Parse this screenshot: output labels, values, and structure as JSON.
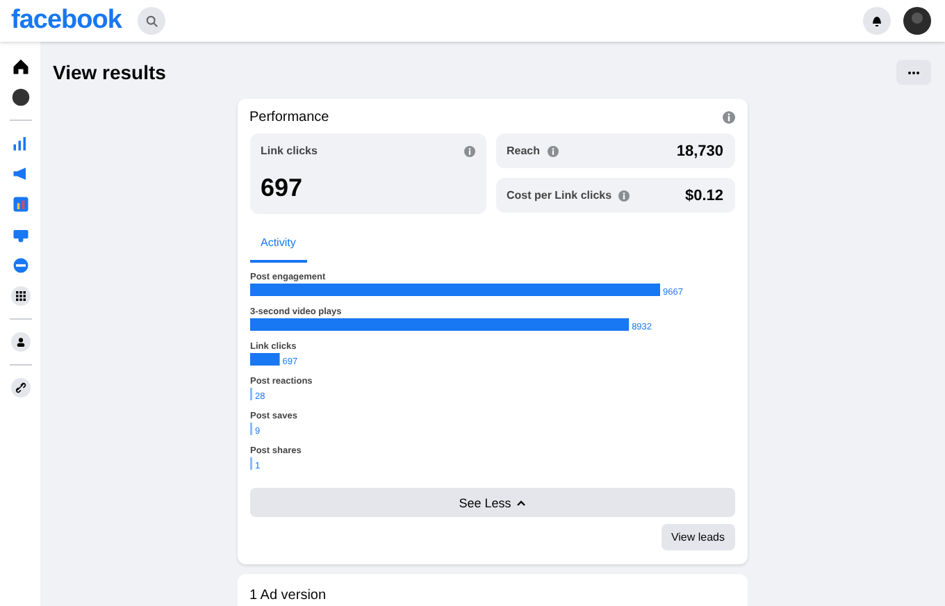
{
  "topbar": {
    "logo": "facebook"
  },
  "page": {
    "title": "View results"
  },
  "performance": {
    "title": "Performance",
    "primary_metric": {
      "label": "Link clicks",
      "value": "697"
    },
    "metrics": [
      {
        "label": "Reach",
        "value": "18,730"
      },
      {
        "label": "Cost per Link clicks",
        "value": "$0.12"
      }
    ],
    "tabs": [
      {
        "label": "Activity",
        "selected": true
      }
    ],
    "chart_data": {
      "type": "bar",
      "orientation": "horizontal",
      "categories": [
        "Post engagement",
        "3-second video plays",
        "Link clicks",
        "Post reactions",
        "Post saves",
        "Post shares"
      ],
      "values": [
        9667,
        8932,
        697,
        28,
        9,
        1
      ],
      "data_labels": true
    },
    "see_less": "See Less",
    "view_leads": "View leads"
  },
  "next_card": {
    "title": "1 Ad version"
  }
}
